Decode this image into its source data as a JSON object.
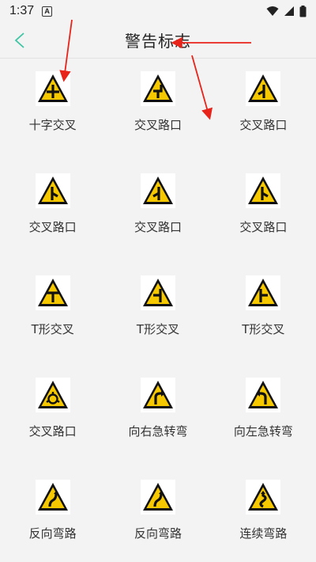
{
  "status_bar": {
    "time": "1:37",
    "badge": "A"
  },
  "header": {
    "title": "警告标志"
  },
  "signs": [
    {
      "label": "十字交叉",
      "icon": "crossroad-sign"
    },
    {
      "label": "交叉路口",
      "icon": "junction-right-offset-sign"
    },
    {
      "label": "交叉路口",
      "icon": "junction-left-branch-sign"
    },
    {
      "label": "交叉路口",
      "icon": "junction-right-branch-sign"
    },
    {
      "label": "交叉路口",
      "icon": "junction-left-branch-sign"
    },
    {
      "label": "交叉路口",
      "icon": "junction-right-branch-sign"
    },
    {
      "label": "T形交叉",
      "icon": "t-junction-sign"
    },
    {
      "label": "T形交叉",
      "icon": "t-junction-left-sign"
    },
    {
      "label": "T形交叉",
      "icon": "t-junction-right-sign"
    },
    {
      "label": "交叉路口",
      "icon": "roundabout-sign"
    },
    {
      "label": "向右急转弯",
      "icon": "sharp-right-turn-sign"
    },
    {
      "label": "向左急转弯",
      "icon": "sharp-left-turn-sign"
    },
    {
      "label": "反向弯路",
      "icon": "reverse-curve-sign"
    },
    {
      "label": "反向弯路",
      "icon": "reverse-curve-sign"
    },
    {
      "label": "连续弯路",
      "icon": "winding-road-sign"
    }
  ],
  "colors": {
    "sign_yellow": "#f5c800",
    "sign_black": "#111111",
    "accent": "#3ec6a4",
    "annotation_red": "#e8231a"
  }
}
